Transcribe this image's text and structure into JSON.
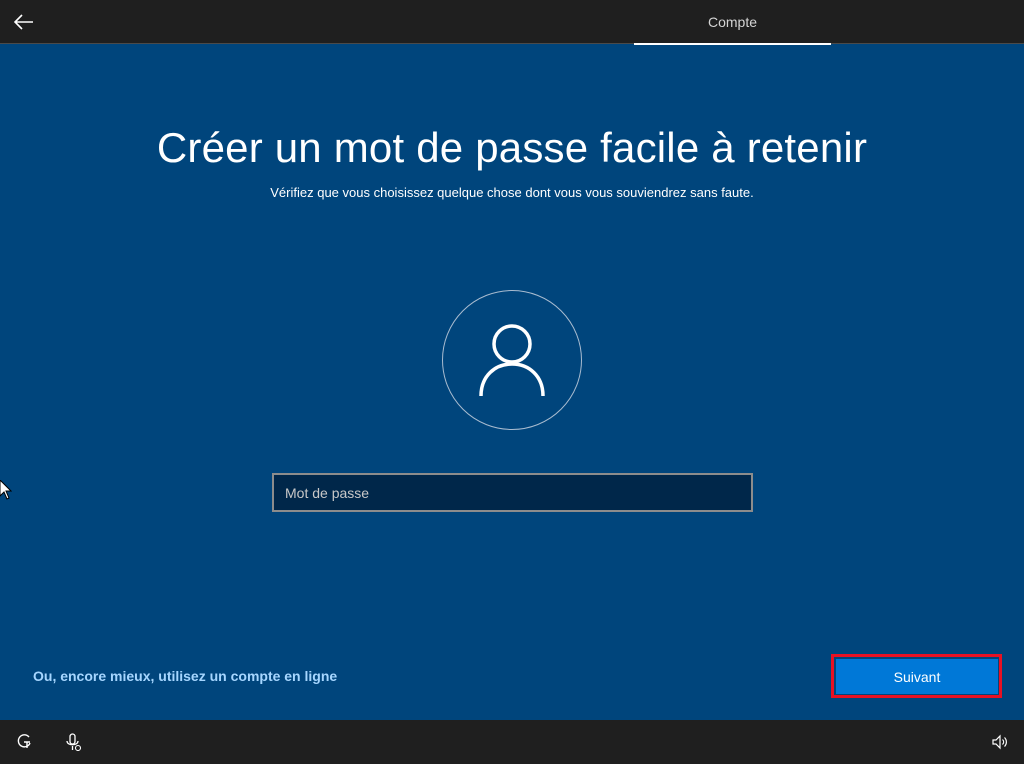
{
  "header": {
    "back_icon": "back-arrow-icon",
    "tab_label": "Compte"
  },
  "main": {
    "title": "Créer un mot de passe facile à retenir",
    "subtitle": "Vérifiez que vous choisissez quelque chose dont vous vous souviendrez sans faute.",
    "avatar_icon": "user-icon",
    "password_placeholder": "Mot de passe",
    "password_value": ""
  },
  "footer": {
    "online_account_link": "Ou, encore mieux, utilisez un compte en ligne",
    "next_label": "Suivant"
  },
  "taskbar": {
    "icons": [
      "ease-of-access-icon",
      "microphone-icon",
      "volume-icon"
    ]
  },
  "colors": {
    "background": "#00457c",
    "bars": "#1f1f1f",
    "accent_button": "#0078d7",
    "link": "#a6d6ff",
    "highlight": "#e81123"
  }
}
